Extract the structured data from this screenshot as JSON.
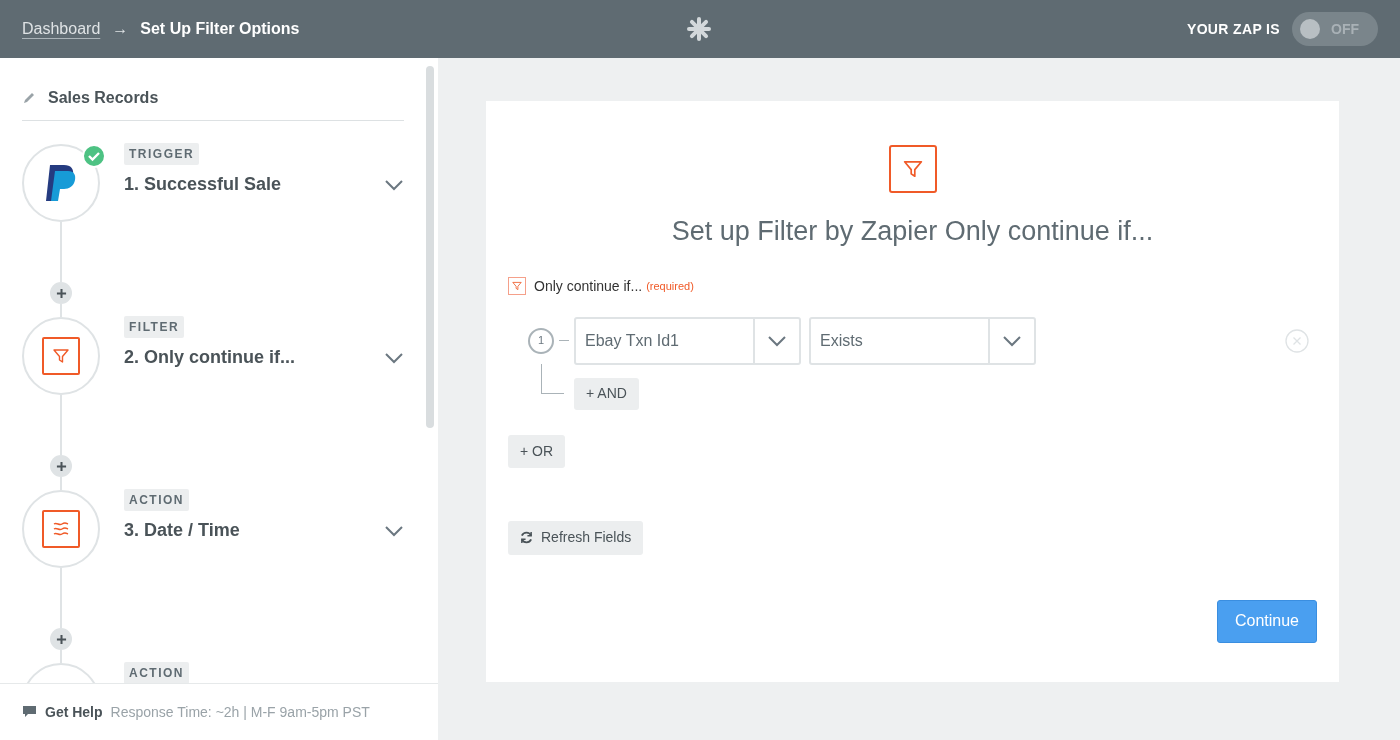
{
  "header": {
    "breadcrumb_link": "Dashboard",
    "breadcrumb_arrow": "→",
    "page_title": "Set Up Filter Options",
    "zap_label": "YOUR ZAP IS",
    "zap_toggle": {
      "on": false,
      "label": "OFF"
    }
  },
  "sidebar": {
    "zap_name": "Sales Records",
    "steps": [
      {
        "kind": "paypal",
        "badge": "TRIGGER",
        "title": "1. Successful Sale",
        "done": true
      },
      {
        "kind": "filter",
        "badge": "FILTER",
        "title": "2. Only continue if...",
        "done": false
      },
      {
        "kind": "datetime",
        "badge": "ACTION",
        "title": "3. Date / Time",
        "done": false
      },
      {
        "kind": "hidden",
        "badge": "ACTION",
        "done": false
      }
    ],
    "help": {
      "label": "Get Help",
      "info": "Response Time: ~2h | M-F 9am-5pm PST"
    }
  },
  "panel": {
    "heading": "Set up Filter by Zapier Only continue if...",
    "field_label": "Only continue if...",
    "required": "(required)",
    "rules": [
      {
        "number": "1",
        "field": "Ebay Txn Id1",
        "condition": "Exists"
      }
    ],
    "and_button": "+ AND",
    "or_button": "+ OR",
    "refresh_button": "Refresh Fields",
    "continue_button": "Continue"
  }
}
